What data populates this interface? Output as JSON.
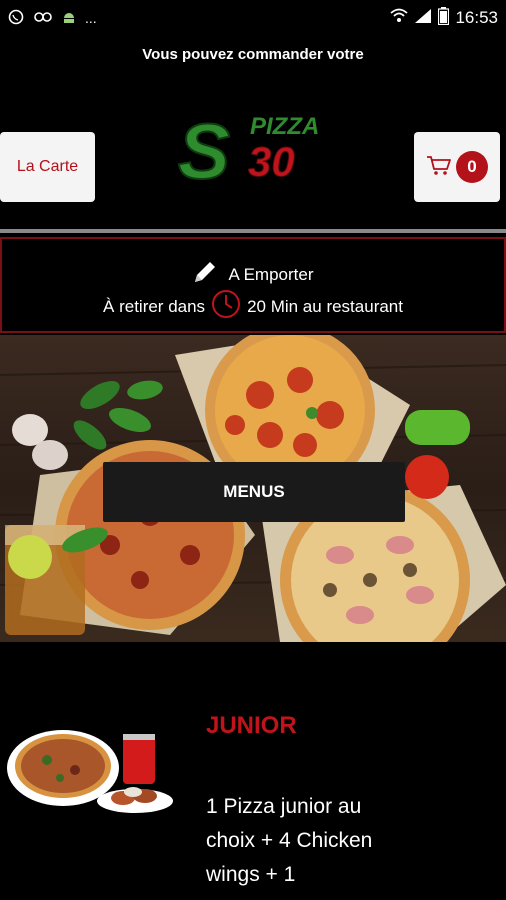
{
  "status_bar": {
    "time": "16:53",
    "dots": "...",
    "icons": [
      "whatsapp-icon",
      "link-icon",
      "android-icon",
      "wifi-icon",
      "signal-icon",
      "battery-icon"
    ]
  },
  "marquee": {
    "text": "Vous pouvez commander votre"
  },
  "header": {
    "menu_button_label": "La Carte",
    "logo": {
      "letter": "S",
      "word": "PIZZA",
      "number": "30"
    },
    "cart": {
      "count": "0"
    }
  },
  "order_mode": {
    "mode": "A Emporter",
    "pickup_prefix": "À retirer dans",
    "pickup_time": "20 Min au restaurant"
  },
  "hero": {
    "button_label": "MENUS"
  },
  "menu_item": {
    "title": "JUNIOR",
    "description": "1 Pizza junior au choix + 4 Chicken wings + 1"
  },
  "colors": {
    "brand_red": "#b3121b",
    "logo_green": "#2e8b2e",
    "background": "#000000"
  }
}
